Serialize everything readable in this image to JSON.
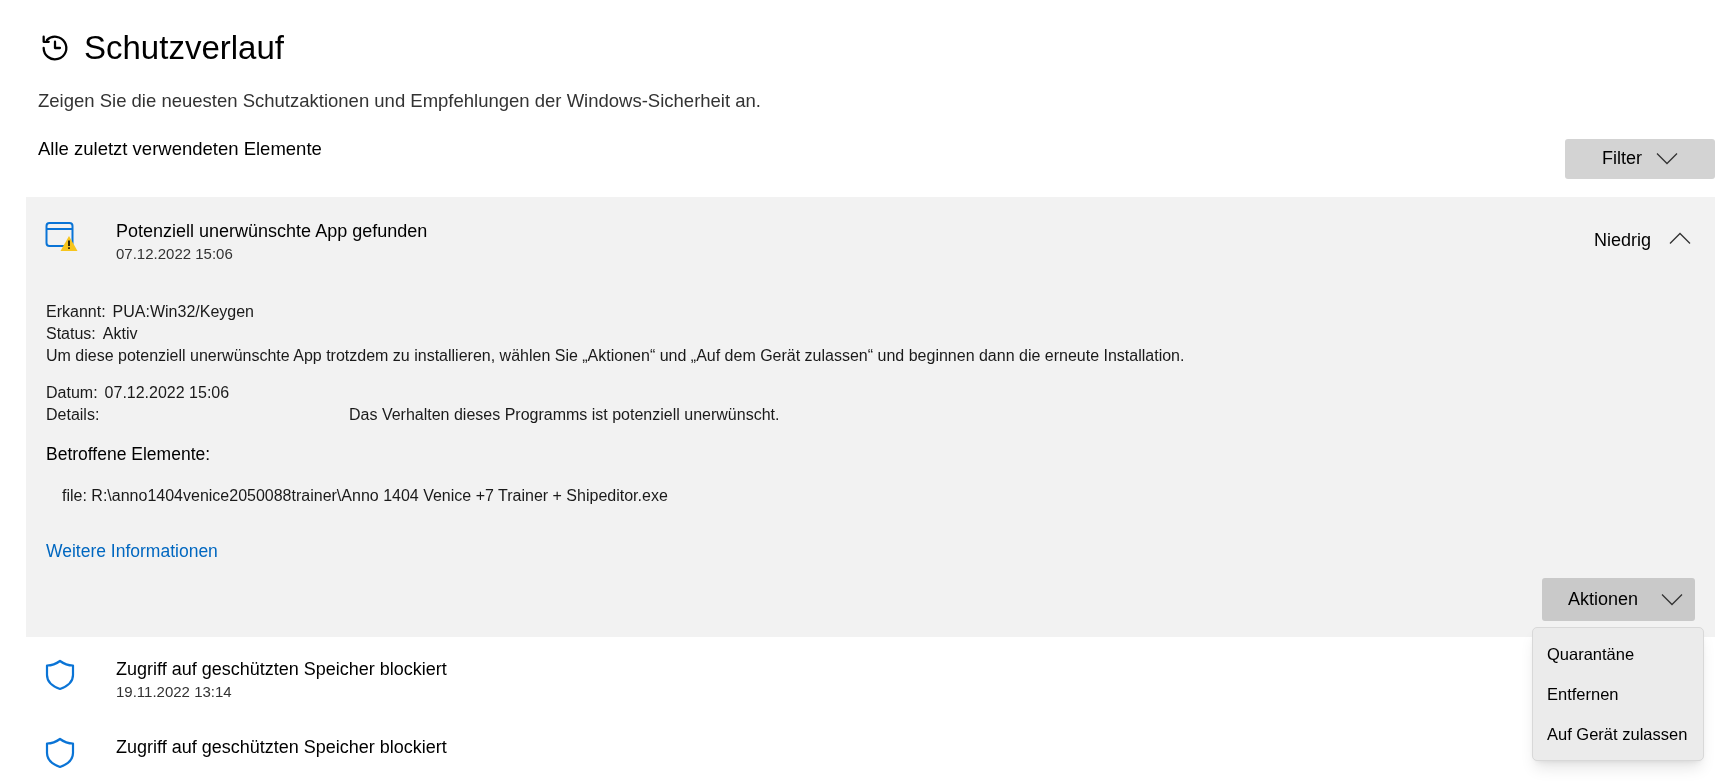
{
  "page": {
    "title": "Schutzverlauf",
    "description": "Zeigen Sie die neuesten Schutzaktionen und Empfehlungen der Windows-Sicherheit an.",
    "section_label": "Alle zuletzt verwendeten Elemente",
    "filter_button": "Filter"
  },
  "items": [
    {
      "kind": "app",
      "title": "Potenziell unerwünschte App gefunden",
      "date": "07.12.2022 15:06",
      "expanded": true,
      "severity": "Niedrig",
      "details": [
        {
          "kind": "inline",
          "label": "Erkannt:",
          "value": "PUA:Win32/Keygen"
        },
        {
          "kind": "inline",
          "label": "Status:",
          "value": "Aktiv"
        },
        {
          "kind": "note",
          "value": "Um diese potenziell unerwünschte App trotzdem zu installieren, wählen Sie „Aktionen“ und „Auf dem Gerät zulassen“ und beginnen dann die erneute Installation."
        },
        {
          "kind": "inline",
          "label": "Datum:",
          "value": "07.12.2022 15:06"
        },
        {
          "kind": "tabbed",
          "label": "Details:",
          "value": "Das Verhalten dieses Programms ist potenziell unerwünscht."
        }
      ],
      "affected_heading": "Betroffene Elemente:",
      "affected": [
        "file: R:\\anno1404venice2050088trainer\\Anno 1404 Venice +7 Trainer + Shipeditor.exe"
      ],
      "link": "Weitere Informationen",
      "actions_button": {
        "label": "Aktionen",
        "open": true
      },
      "menu": [
        "Quarantäne",
        "Entfernen",
        "Auf Gerät zulassen"
      ]
    },
    {
      "kind": "shield",
      "title": "Zugriff auf geschützten Speicher blockiert",
      "date": "19.11.2022 13:14",
      "expanded": false
    },
    {
      "kind": "shield",
      "title": "Zugriff auf geschützten Speicher blockiert",
      "expanded": false
    }
  ]
}
